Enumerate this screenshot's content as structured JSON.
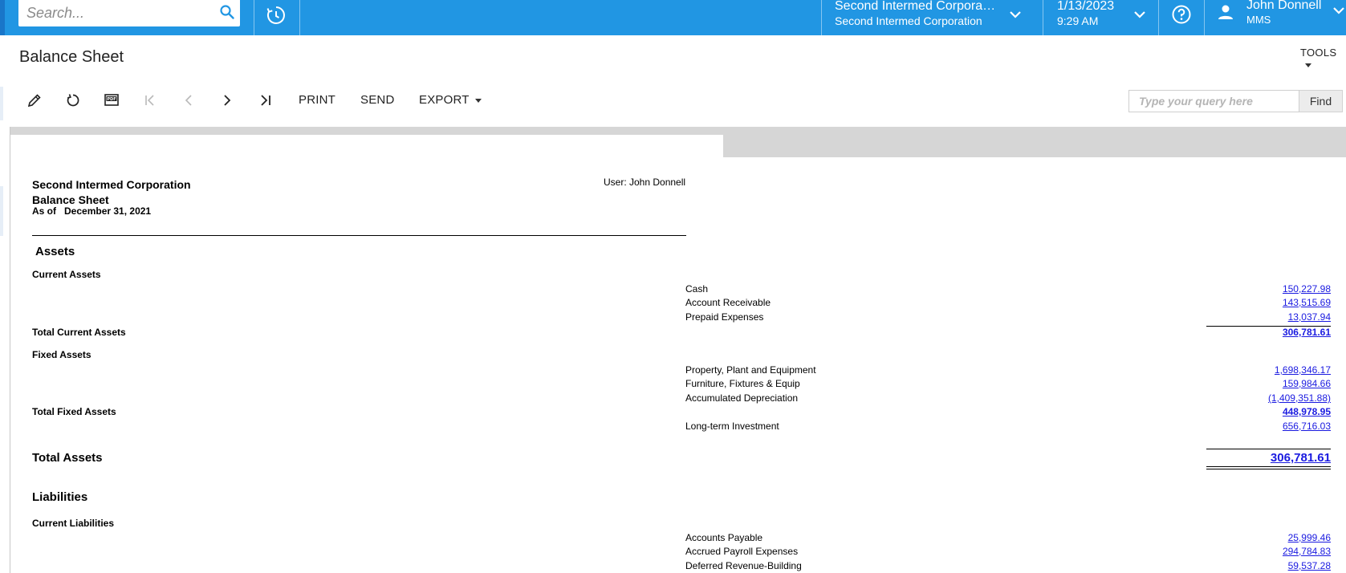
{
  "topbar": {
    "search_placeholder": "Search...",
    "branch_line1": "Second Intermed Corpora…",
    "branch_line2": "Second Intermed Corporation",
    "date": "1/13/2023",
    "time": "9:29 AM",
    "user_name": "John Donnell",
    "user_company": "MMS",
    "brand_color": "#2196e3"
  },
  "page": {
    "title": "Balance Sheet",
    "tools_label": "TOOLS"
  },
  "toolbar": {
    "icons": [
      "edit-icon",
      "refresh-icon",
      "pdf-icon",
      "first-page-icon",
      "previous-page-icon",
      "next-page-icon",
      "last-page-icon"
    ],
    "print_label": "PRINT",
    "send_label": "SEND",
    "export_label": "EXPORT",
    "query_placeholder": "Type your query here",
    "find_label": "Find"
  },
  "report": {
    "company": "Second Intermed Corporation",
    "title": "Balance Sheet",
    "as_of_label": "As of",
    "as_of_date": "December 31, 2021",
    "user_line": "User: John Donnell",
    "assets_heading": "Assets",
    "current_assets_heading": "Current Assets",
    "current_assets": [
      {
        "label": "Cash",
        "amount": "150,227.98"
      },
      {
        "label": "Account Receivable",
        "amount": "143,515.69"
      },
      {
        "label": "Prepaid Expenses",
        "amount": "13,037.94"
      }
    ],
    "total_current_assets_label": "Total Current Assets",
    "total_current_assets": "306,781.61",
    "fixed_assets_heading": "Fixed Assets",
    "fixed_assets": [
      {
        "label": "Property, Plant and Equipment",
        "amount": "1,698,346.17"
      },
      {
        "label": "Furniture, Fixtures & Equip",
        "amount": "159,984.66"
      },
      {
        "label": "Accumulated Depreciation",
        "amount": "(1,409,351.88)"
      }
    ],
    "total_fixed_assets_label": "Total Fixed Assets",
    "total_fixed_assets": "448,978.95",
    "long_term_label": "Long-term Investment",
    "long_term_amount": "656,716.03",
    "total_assets_label": "Total Assets",
    "total_assets": "306,781.61",
    "liabilities_heading": "Liabilities",
    "current_liabilities_heading": "Current Liabilities",
    "current_liabilities": [
      {
        "label": "Accounts Payable",
        "amount": "25,999.46"
      },
      {
        "label": "Accrued Payroll Expenses",
        "amount": "294,784.83"
      },
      {
        "label": "Deferred Revenue-Building",
        "amount": "59,537.28"
      }
    ],
    "amount_link_color": "#1a1ae0"
  }
}
